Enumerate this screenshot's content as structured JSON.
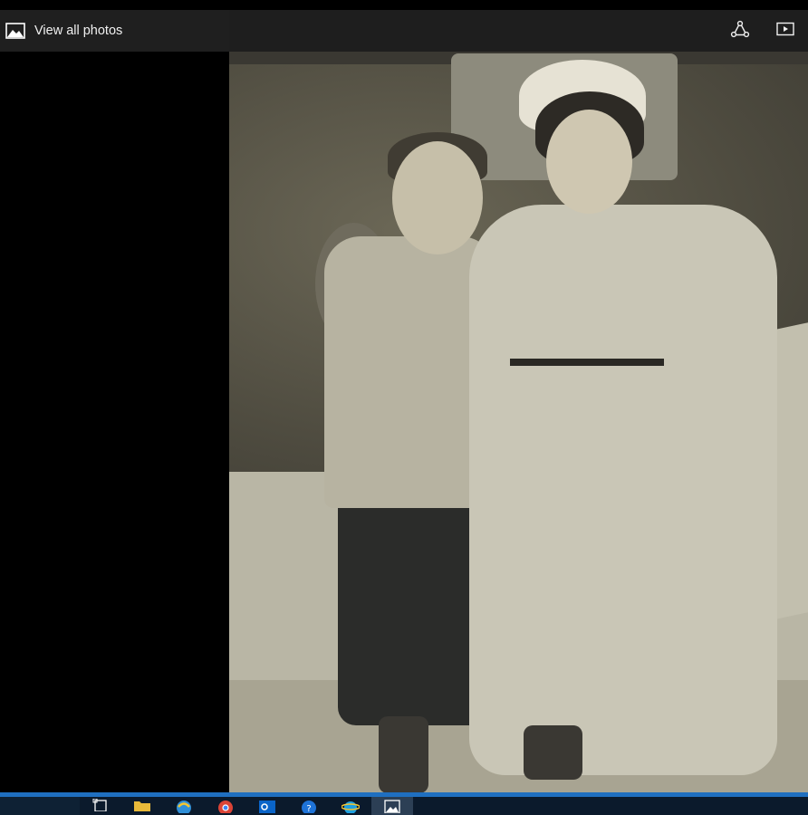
{
  "command_bar": {
    "view_all_photos_label": "View all photos"
  },
  "icons": {
    "photo": "photo-icon",
    "share": "share-icon",
    "slideshow": "slideshow-icon"
  },
  "taskbar": {
    "items": [
      {
        "name": "task-view"
      },
      {
        "name": "file-explorer"
      },
      {
        "name": "edge-browser"
      },
      {
        "name": "chrome"
      },
      {
        "name": "outlook"
      },
      {
        "name": "help"
      },
      {
        "name": "ie-browser"
      },
      {
        "name": "photos-app",
        "active": true
      }
    ]
  },
  "colors": {
    "taskbar_accent": "#1f6fc0",
    "command_bar_bg": "#1f1f1f",
    "taskbar_bg": "#0b1a2c"
  }
}
